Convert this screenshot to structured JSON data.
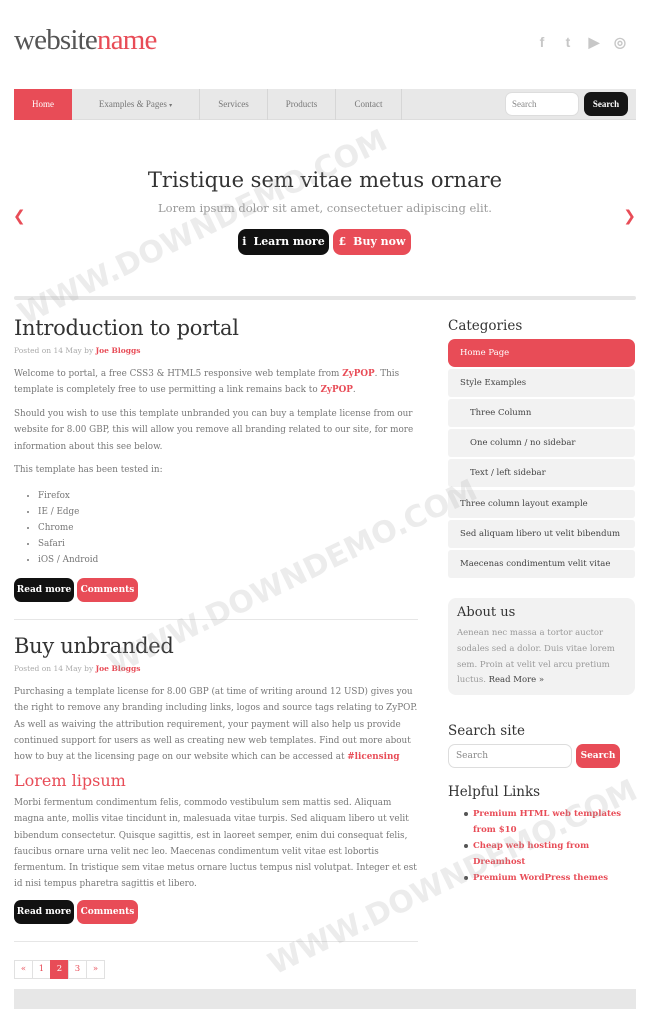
{
  "header": {
    "logo_part1": "website",
    "logo_part2": "name",
    "social": [
      "facebook-icon",
      "twitter-icon",
      "youtube-icon",
      "instagram-icon"
    ]
  },
  "nav": {
    "items": [
      "Home",
      "Examples & Pages",
      "Services",
      "Products",
      "Contact"
    ],
    "dropdown_caret": "▾",
    "search_placeholder": "Search",
    "search_button": "Search"
  },
  "hero": {
    "title": "Tristique sem vitae metus ornare",
    "subtitle": "Lorem ipsum dolor sit amet, consectetuer adipiscing elit.",
    "learn_icon": "i",
    "learn_more": "Learn more",
    "buy_icon": "£",
    "buy_now": "Buy now",
    "prev_arrow": "❮",
    "next_arrow": "❯"
  },
  "post1": {
    "title": "Introduction to portal",
    "meta_prefix": "Posted on 14 May by",
    "author": "Joe Bloggs",
    "p1_a": "Welcome to portal, a free CSS3 & HTML5 responsive web template from",
    "p1_link1": "ZyPOP",
    "p1_b": ". This template is completely free to use permitting a link remains back to",
    "p1_link2": "ZyPOP",
    "p1_c": ".",
    "p2": "Should you wish to use this template unbranded you can buy a template license from our website for 8.00 GBP, this will allow you remove all branding related to our site, for more information about this see below.",
    "p3": "This template has been tested in:",
    "browsers": [
      "Firefox",
      "IE / Edge",
      "Chrome",
      "Safari",
      "iOS / Android"
    ],
    "read_more": "Read more",
    "comments": "Comments"
  },
  "post2": {
    "title": "Buy unbranded",
    "meta_prefix": "Posted on 14 May by",
    "author": "Joe Bloggs",
    "p1_a": "Purchasing a template license for 8.00 GBP (at time of writing around 12 USD) gives you the right to remove any branding including links, logos and source tags relating to ZyPOP. As well as waiving the attribution requirement, your payment will also help us provide continued support for users as well as creating new web templates. Find out more about how to buy at the licensing page on our website which can be accessed at",
    "p1_link": "#licensing",
    "subheading": "Lorem lipsum",
    "p2": "Morbi fermentum condimentum felis, commodo vestibulum sem mattis sed. Aliquam magna ante, mollis vitae tincidunt in, malesuada vitae turpis. Sed aliquam libero ut velit bibendum consectetur. Quisque sagittis, est in laoreet semper, enim dui consequat felis, faucibus ornare urna velit nec leo. Maecenas condimentum velit vitae est lobortis fermentum. In tristique sem vitae metus ornare luctus tempus nisl volutpat. Integer et est id nisi tempus pharetra sagittis et libero.",
    "read_more": "Read more",
    "comments": "Comments"
  },
  "pagination": [
    "«",
    "1",
    "2",
    "3",
    "»"
  ],
  "pagination_current": "2",
  "sidebar": {
    "categories_title": "Categories",
    "categories": [
      "Home Page",
      "Style Examples",
      "Three Column",
      "One column / no sidebar",
      "Text / left sidebar",
      "Three column layout example",
      "Sed aliquam libero ut velit bibendum",
      "Maecenas condimentum velit vitae"
    ],
    "about_title": "About us",
    "about_text": "Aenean nec massa a tortor auctor sodales sed a dolor. Duis vitae lorem sem. Proin at velit vel arcu pretium luctus.",
    "about_link": "Read More »",
    "search_title": "Search site",
    "search_placeholder": "Search",
    "search_button": "Search",
    "links_title": "Helpful Links",
    "links": [
      "Premium HTML web templates from $10",
      "Cheap web hosting from Dreamhost",
      "Premium WordPress themes"
    ]
  },
  "watermark": "WWW.DOWNDEMO.COM",
  "colors": {
    "accent": "#e84c57",
    "dark": "#111111",
    "panel": "#f2f2f2"
  }
}
